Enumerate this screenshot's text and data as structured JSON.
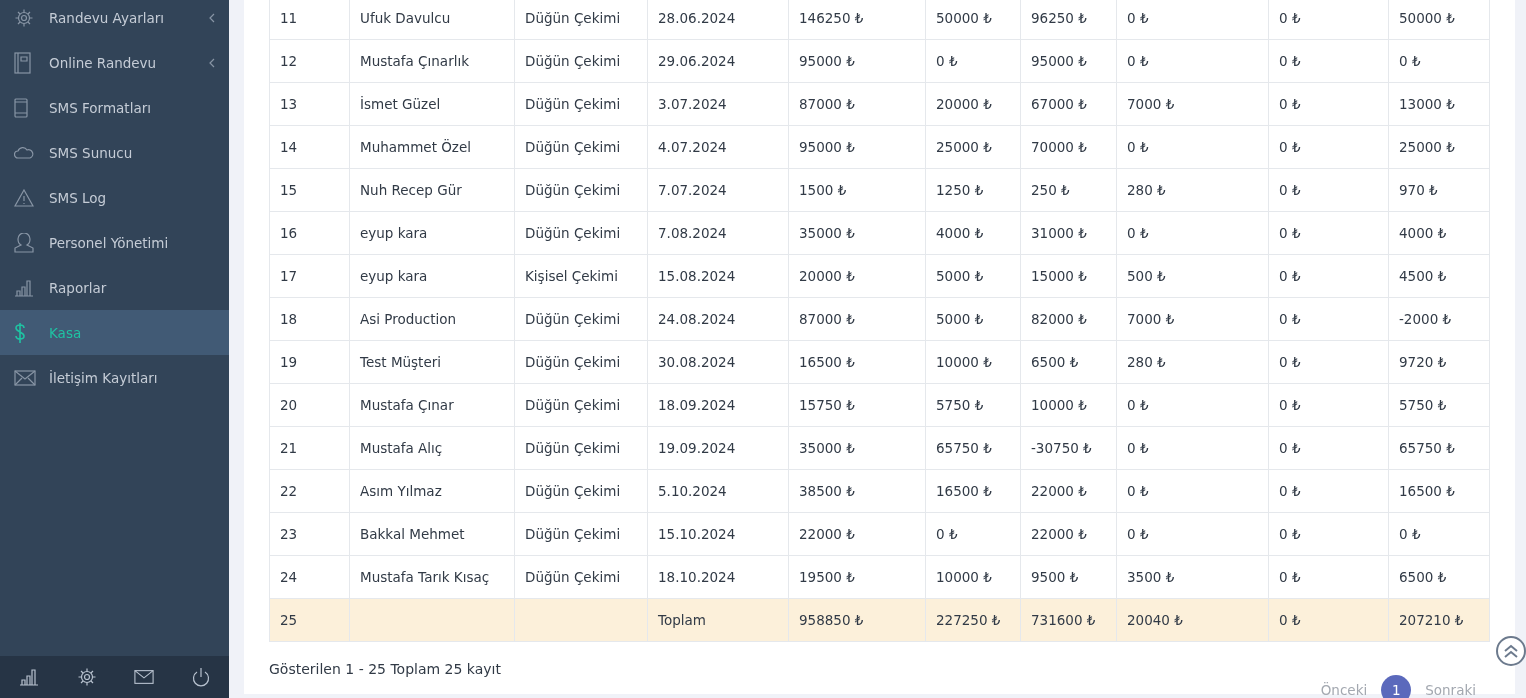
{
  "sidebar": {
    "items": [
      {
        "label": "Randevu Ayarları",
        "selected": false,
        "expandable": true
      },
      {
        "label": "Online Randevu",
        "selected": false,
        "expandable": true
      },
      {
        "label": "SMS Formatları",
        "selected": false,
        "expandable": false
      },
      {
        "label": "SMS Sunucu",
        "selected": false,
        "expandable": false
      },
      {
        "label": "SMS Log",
        "selected": false,
        "expandable": false
      },
      {
        "label": "Personel Yönetimi",
        "selected": false,
        "expandable": false
      },
      {
        "label": "Raporlar",
        "selected": false,
        "expandable": false
      },
      {
        "label": "Kasa",
        "selected": true,
        "expandable": false
      },
      {
        "label": "İletişim Kayıtları",
        "selected": false,
        "expandable": false
      }
    ]
  },
  "table": {
    "rows": [
      {
        "kind": "data",
        "cells": [
          "11",
          "Ufuk Davulcu",
          "Düğün Çekimi",
          "28.06.2024",
          "146250 ₺",
          "50000 ₺",
          "96250 ₺",
          "0 ₺",
          "0 ₺",
          "50000 ₺"
        ]
      },
      {
        "kind": "data",
        "cells": [
          "12",
          "Mustafa Çınarlık",
          "Düğün Çekimi",
          "29.06.2024",
          "95000 ₺",
          "0 ₺",
          "95000 ₺",
          "0 ₺",
          "0 ₺",
          "0 ₺"
        ]
      },
      {
        "kind": "data",
        "cells": [
          "13",
          "İsmet Güzel",
          "Düğün Çekimi",
          "3.07.2024",
          "87000 ₺",
          "20000 ₺",
          "67000 ₺",
          "7000 ₺",
          "0 ₺",
          "13000 ₺"
        ]
      },
      {
        "kind": "data",
        "cells": [
          "14",
          "Muhammet Özel",
          "Düğün Çekimi",
          "4.07.2024",
          "95000 ₺",
          "25000 ₺",
          "70000 ₺",
          "0 ₺",
          "0 ₺",
          "25000 ₺"
        ]
      },
      {
        "kind": "data",
        "cells": [
          "15",
          "Nuh Recep Gür",
          "Düğün Çekimi",
          "7.07.2024",
          "1500 ₺",
          "1250 ₺",
          "250 ₺",
          "280 ₺",
          "0 ₺",
          "970 ₺"
        ]
      },
      {
        "kind": "data",
        "cells": [
          "16",
          "eyup kara",
          "Düğün Çekimi",
          "7.08.2024",
          "35000 ₺",
          "4000 ₺",
          "31000 ₺",
          "0 ₺",
          "0 ₺",
          "4000 ₺"
        ]
      },
      {
        "kind": "data",
        "cells": [
          "17",
          "eyup kara",
          "Kişisel Çekimi",
          "15.08.2024",
          "20000 ₺",
          "5000 ₺",
          "15000 ₺",
          "500 ₺",
          "0 ₺",
          "4500 ₺"
        ]
      },
      {
        "kind": "data",
        "cells": [
          "18",
          "Asi Production",
          "Düğün Çekimi",
          "24.08.2024",
          "87000 ₺",
          "5000 ₺",
          "82000 ₺",
          "7000 ₺",
          "0 ₺",
          "-2000 ₺"
        ]
      },
      {
        "kind": "data",
        "cells": [
          "19",
          "Test Müşteri",
          "Düğün Çekimi",
          "30.08.2024",
          "16500 ₺",
          "10000 ₺",
          "6500 ₺",
          "280 ₺",
          "0 ₺",
          "9720 ₺"
        ]
      },
      {
        "kind": "data",
        "cells": [
          "20",
          "Mustafa Çınar",
          "Düğün Çekimi",
          "18.09.2024",
          "15750 ₺",
          "5750 ₺",
          "10000 ₺",
          "0 ₺",
          "0 ₺",
          "5750 ₺"
        ]
      },
      {
        "kind": "data",
        "cells": [
          "21",
          "Mustafa Alıç",
          "Düğün Çekimi",
          "19.09.2024",
          "35000 ₺",
          "65750 ₺",
          "-30750 ₺",
          "0 ₺",
          "0 ₺",
          "65750 ₺"
        ]
      },
      {
        "kind": "data",
        "cells": [
          "22",
          "Asım Yılmaz",
          "Düğün Çekimi",
          "5.10.2024",
          "38500 ₺",
          "16500 ₺",
          "22000 ₺",
          "0 ₺",
          "0 ₺",
          "16500 ₺"
        ]
      },
      {
        "kind": "data",
        "cells": [
          "23",
          "Bakkal Mehmet",
          "Düğün Çekimi",
          "15.10.2024",
          "22000 ₺",
          "0 ₺",
          "22000 ₺",
          "0 ₺",
          "0 ₺",
          "0 ₺"
        ]
      },
      {
        "kind": "data",
        "cells": [
          "24",
          "Mustafa Tarık Kısaç",
          "Düğün Çekimi",
          "18.10.2024",
          "19500 ₺",
          "10000 ₺",
          "9500 ₺",
          "3500 ₺",
          "0 ₺",
          "6500 ₺"
        ]
      },
      {
        "kind": "total",
        "number": "25",
        "label": "Toplam",
        "values": [
          "958850 ₺",
          "227250 ₺",
          "731600 ₺",
          "20040 ₺",
          "0 ₺",
          "207210 ₺"
        ]
      }
    ]
  },
  "footer": {
    "info": "Gösterilen 1 - 25 Toplam 25 kayıt"
  },
  "pagination": {
    "previous": "Önceki",
    "pages": [
      {
        "label": "1",
        "selected": true
      }
    ],
    "next": "Sonraki"
  }
}
